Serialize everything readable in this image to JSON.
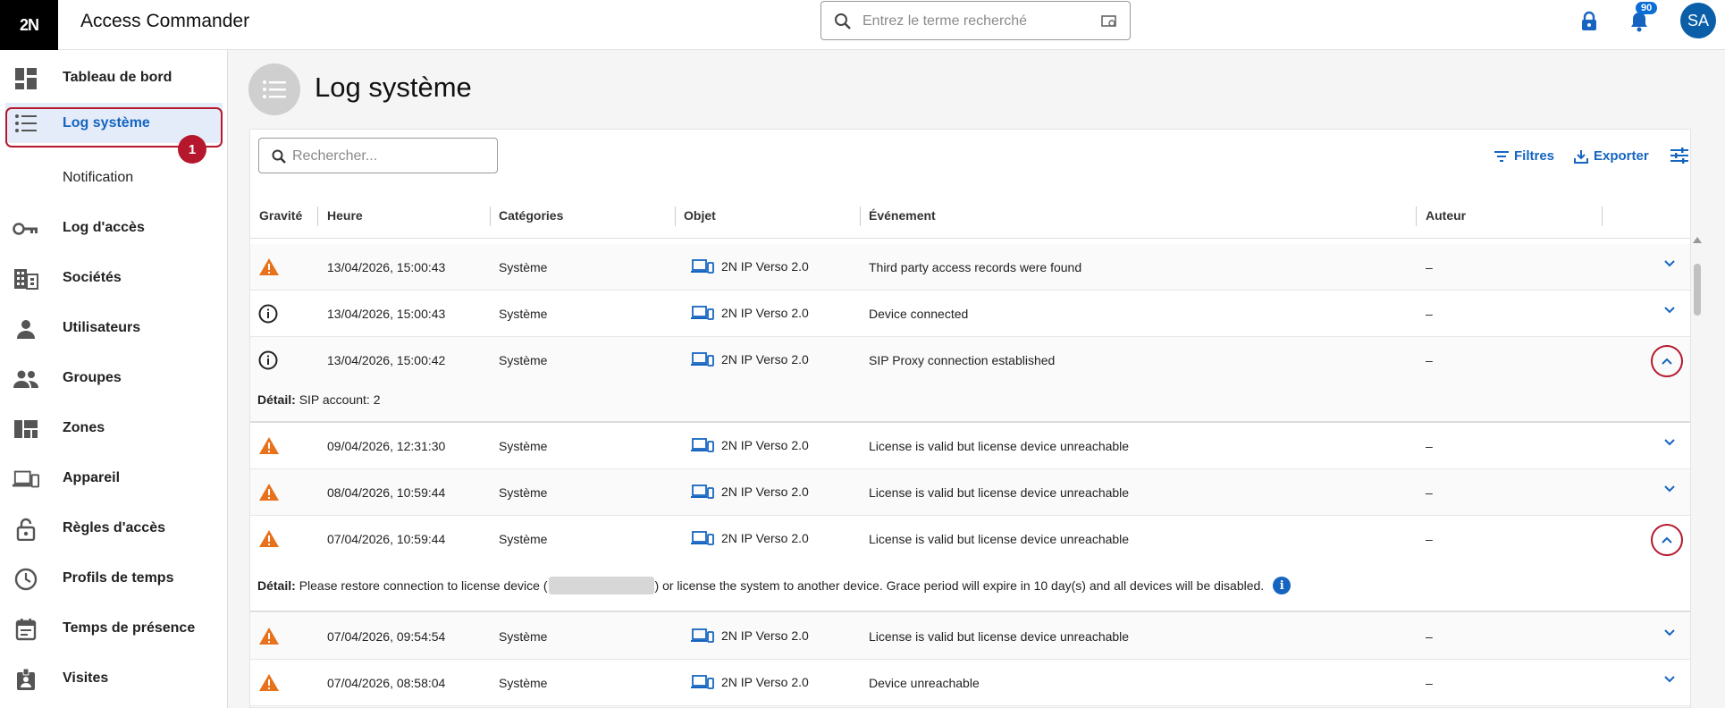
{
  "header": {
    "logo": "2N",
    "app_title": "Access Commander",
    "search_placeholder": "Entrez le terme recherché",
    "notification_count": "90",
    "avatar_initials": "SA"
  },
  "sidebar": {
    "items": [
      {
        "label": "Tableau de bord",
        "icon": "dashboard-icon"
      },
      {
        "label": "Log système",
        "icon": "list-icon",
        "active": true
      },
      {
        "label": "Notification",
        "icon": ""
      },
      {
        "label": "Log d'accès",
        "icon": "key-icon"
      },
      {
        "label": "Sociétés",
        "icon": "building-icon"
      },
      {
        "label": "Utilisateurs",
        "icon": "person-icon"
      },
      {
        "label": "Groupes",
        "icon": "group-icon"
      },
      {
        "label": "Zones",
        "icon": "zones-icon"
      },
      {
        "label": "Appareil",
        "icon": "devices-icon"
      },
      {
        "label": "Règles d'accès",
        "icon": "lock-open-icon"
      },
      {
        "label": "Profils de temps",
        "icon": "clock-icon"
      },
      {
        "label": "Temps de présence",
        "icon": "calendar-icon"
      },
      {
        "label": "Visites",
        "icon": "badge-icon"
      }
    ],
    "step_marker": "1"
  },
  "page": {
    "title": "Log système"
  },
  "toolbar": {
    "search_placeholder": "Rechercher...",
    "filters_label": "Filtres",
    "export_label": "Exporter"
  },
  "table": {
    "columns": [
      "Gravité",
      "Heure",
      "Catégories",
      "Objet",
      "Événement",
      "Auteur"
    ],
    "rows": [
      {
        "severity": "warning",
        "time": "13/04/2026, 15:00:43",
        "category": "Système",
        "object": "2N IP Verso 2.0",
        "event": "Third party access records were found",
        "author": "–",
        "expanded": false
      },
      {
        "severity": "info",
        "time": "13/04/2026, 15:00:43",
        "category": "Système",
        "object": "2N IP Verso 2.0",
        "event": "Device connected",
        "author": "–",
        "expanded": false
      },
      {
        "severity": "info",
        "time": "13/04/2026, 15:00:42",
        "category": "Système",
        "object": "2N IP Verso 2.0",
        "event": "SIP Proxy connection established",
        "author": "–",
        "expanded": true,
        "detail_label": "Détail:",
        "detail_text": "SIP account: 2"
      },
      {
        "severity": "warning",
        "time": "09/04/2026, 12:31:30",
        "category": "Système",
        "object": "2N IP Verso 2.0",
        "event": "License is valid but license device unreachable",
        "author": "–",
        "expanded": false
      },
      {
        "severity": "warning",
        "time": "08/04/2026, 10:59:44",
        "category": "Système",
        "object": "2N IP Verso 2.0",
        "event": "License is valid but license device unreachable",
        "author": "–",
        "expanded": false
      },
      {
        "severity": "warning",
        "time": "07/04/2026, 10:59:44",
        "category": "Système",
        "object": "2N IP Verso 2.0",
        "event": "License is valid but license device unreachable",
        "author": "–",
        "expanded": true,
        "detail_label": "Détail:",
        "detail_text_before": "Please restore connection to license device (",
        "detail_text_after": ") or license the system to another device. Grace period will expire in 10 day(s) and all devices will be disabled."
      },
      {
        "severity": "warning",
        "time": "07/04/2026, 09:54:54",
        "category": "Système",
        "object": "2N IP Verso 2.0",
        "event": "License is valid but license device unreachable",
        "author": "–",
        "expanded": false
      },
      {
        "severity": "warning",
        "time": "07/04/2026, 08:58:04",
        "category": "Système",
        "object": "2N IP Verso 2.0",
        "event": "Device unreachable",
        "author": "–",
        "expanded": false
      }
    ]
  },
  "colors": {
    "accent": "#1565c0",
    "highlight": "#b5182c",
    "warning": "#e8711c",
    "active_bg": "#e4ecfa"
  }
}
